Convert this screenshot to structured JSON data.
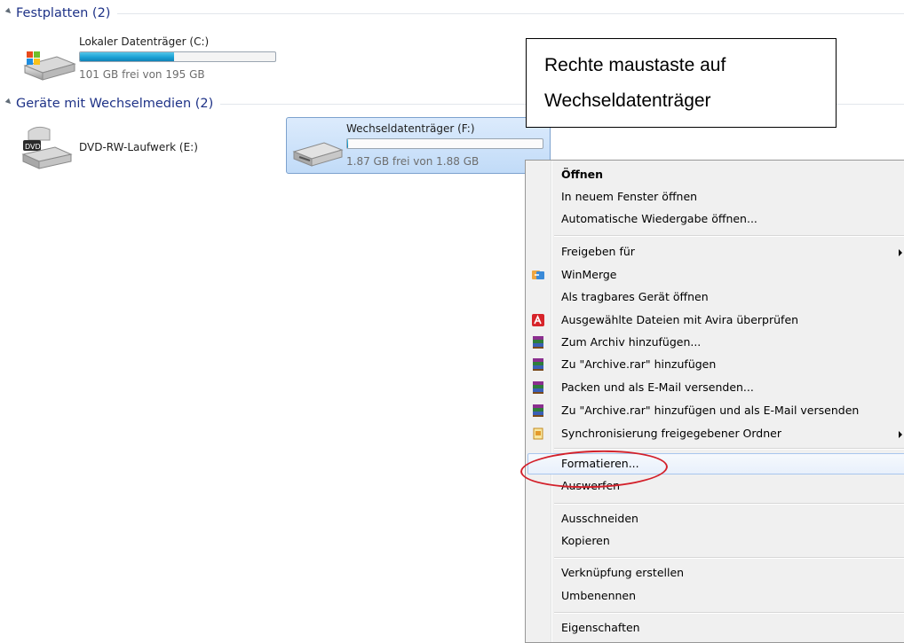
{
  "groups": {
    "hard_disks": {
      "title": "Festplatten (2)"
    },
    "removable": {
      "title": "Geräte mit Wechselmedien (2)"
    }
  },
  "drives": {
    "local_c": {
      "name": "Lokaler Datenträger (C:)",
      "space": "101 GB frei von 195 GB",
      "used_fraction": 0.48
    },
    "dvd_e": {
      "name": "DVD-RW-Laufwerk (E:)",
      "badge": "DVD"
    },
    "removable_f": {
      "name": "Wechseldatenträger (F:)",
      "space": "1.87 GB frei von 1.88 GB",
      "used_fraction": 0.005
    }
  },
  "callout": {
    "line1": "Rechte maustaste auf",
    "line2": "Wechseldatenträger"
  },
  "menu": {
    "items": [
      {
        "label": "Öffnen",
        "bold": true
      },
      {
        "label": "In neuem Fenster öffnen"
      },
      {
        "label": "Automatische Wiedergabe öffnen..."
      },
      {
        "label": "Freigeben für",
        "submenu": true
      },
      {
        "label": "WinMerge",
        "icon": "winmerge-icon"
      },
      {
        "label": "Als tragbares Gerät öffnen"
      },
      {
        "label": "Ausgewählte Dateien mit Avira überprüfen",
        "icon": "avira-icon"
      },
      {
        "label": "Zum Archiv hinzufügen...",
        "icon": "winrar-icon"
      },
      {
        "label": "Zu \"Archive.rar\" hinzufügen",
        "icon": "winrar-icon"
      },
      {
        "label": "Packen und als E-Mail versenden...",
        "icon": "winrar-icon"
      },
      {
        "label": "Zu \"Archive.rar\" hinzufügen und als E-Mail versenden",
        "icon": "winrar-icon"
      },
      {
        "label": "Synchronisierung freigegebener Ordner",
        "icon": "sync-folder-icon",
        "submenu": true
      },
      {
        "label": "Formatieren...",
        "highlighted": true
      },
      {
        "label": "Auswerfen"
      },
      {
        "label": "Ausschneiden"
      },
      {
        "label": "Kopieren"
      },
      {
        "label": "Verknüpfung erstellen"
      },
      {
        "label": "Umbenennen"
      },
      {
        "label": "Eigenschaften"
      }
    ]
  },
  "colors": {
    "group_header": "#1e3287",
    "highlight_ring": "#d3202a",
    "selection": "#c1dbf8"
  }
}
